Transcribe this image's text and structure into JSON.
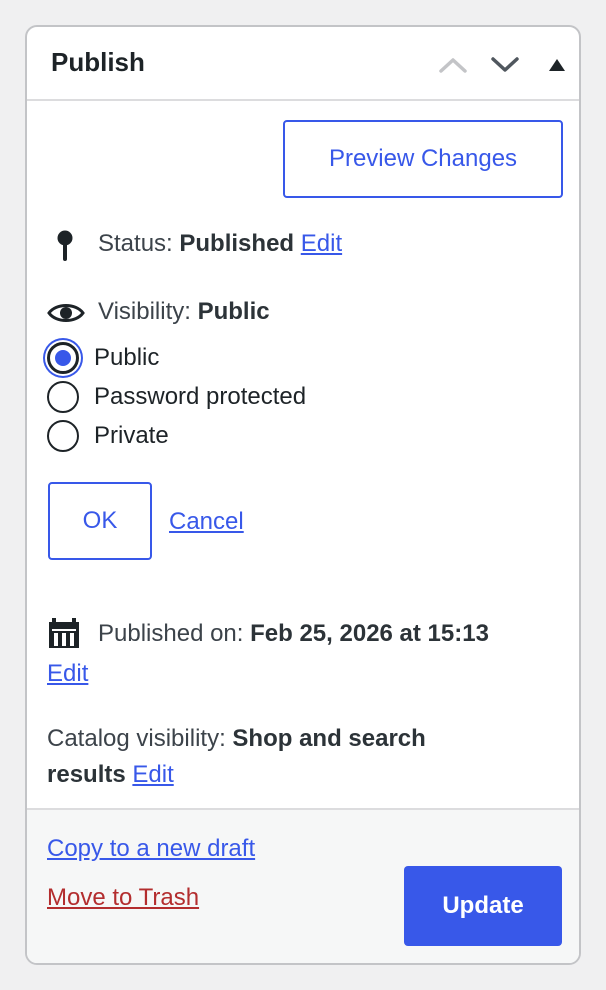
{
  "header": {
    "title": "Publish",
    "move_up_icon": "chevron-up-icon",
    "move_down_icon": "chevron-down-icon",
    "toggle_icon": "triangle-up-icon"
  },
  "preview_label": "Preview Changes",
  "status": {
    "icon": "pin-icon",
    "label": "Status:",
    "value": "Published",
    "edit_label": "Edit"
  },
  "visibility": {
    "icon": "eye-icon",
    "label": "Visibility:",
    "value": "Public",
    "options": [
      {
        "label": "Public",
        "checked": true
      },
      {
        "label": "Password protected",
        "checked": false
      },
      {
        "label": "Private",
        "checked": false
      }
    ],
    "ok_label": "OK",
    "cancel_label": "Cancel"
  },
  "published_on": {
    "icon": "calendar-icon",
    "label": "Published on:",
    "value": "Feb 25, 2026 at 15:13",
    "edit_label": "Edit"
  },
  "catalog_visibility": {
    "label": "Catalog visibility:",
    "value_line1": "Shop and search",
    "value_line2": "results",
    "edit_label": "Edit"
  },
  "footer": {
    "copy_draft_label": "Copy to a new draft",
    "trash_label": "Move to Trash",
    "update_label": "Update"
  },
  "colors": {
    "accent": "#3858e9",
    "danger": "#b32d2e",
    "text": "#1d2327"
  }
}
